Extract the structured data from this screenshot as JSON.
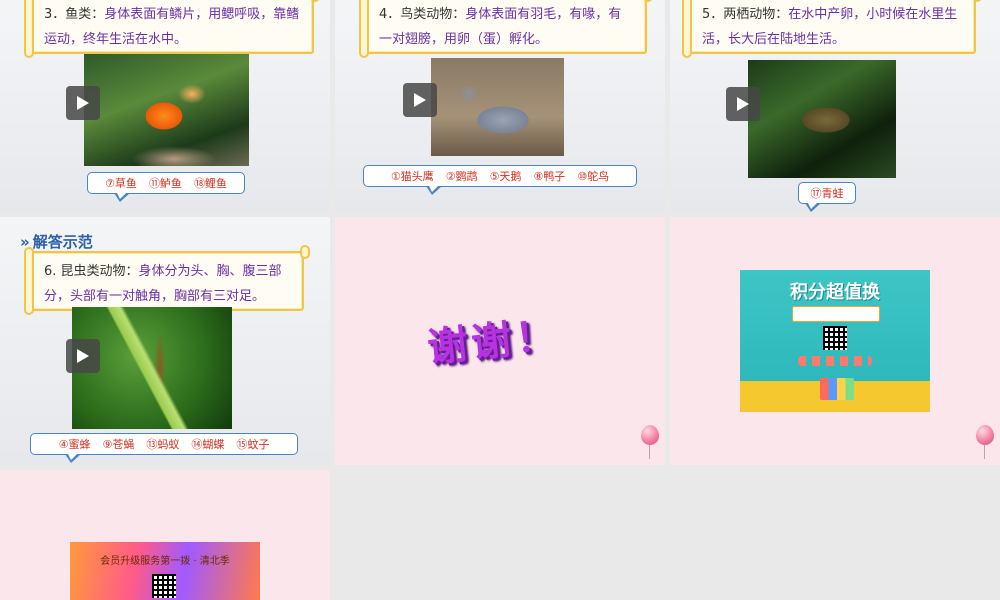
{
  "slides": {
    "fish": {
      "text_prefix": "3．鱼类：",
      "text_body": "身体表面有鳞片，用鳃呼吸，靠鳍运动，终年生活在水中。",
      "answers": [
        "⑦草鱼",
        "⑪鲈鱼",
        "⑱鲤鱼"
      ]
    },
    "bird": {
      "text_prefix": "4．鸟类动物：",
      "text_body": "身体表面有羽毛，有喙，有一对翅膀，用卵（蛋）孵化。",
      "answers": [
        "①猫头鹰",
        "②鹦鹉",
        "⑤天鹅",
        "⑧鸭子",
        "⑩鸵鸟"
      ]
    },
    "amphibian": {
      "text_prefix": "5．两栖动物：",
      "text_body": "在水中产卵，小时候在水里生活，长大后在陆地生活。",
      "answers": [
        "⑰青蛙"
      ]
    },
    "insect": {
      "heading": "解答示范",
      "text_prefix": "6. 昆虫类动物：",
      "text_body": "身体分为头、胸、腹三部分，头部有一对触角，胸部有三对足。",
      "answers": [
        "④蜜蜂",
        "⑨苍蝇",
        "⑬蚂蚁",
        "⑭蝴蝶",
        "⑮蚊子"
      ]
    },
    "thanks": {
      "text": "谢谢！"
    },
    "points_ad": {
      "title": "积分超值换"
    },
    "member_ad": {
      "title": "会员升级服务第一拨 · 清北季"
    }
  },
  "colors": {
    "scroll_border": "#f0c64a",
    "bubble_border": "#4a86c5",
    "answer_text": "#d03020",
    "body_text": "#6b2fa6"
  }
}
